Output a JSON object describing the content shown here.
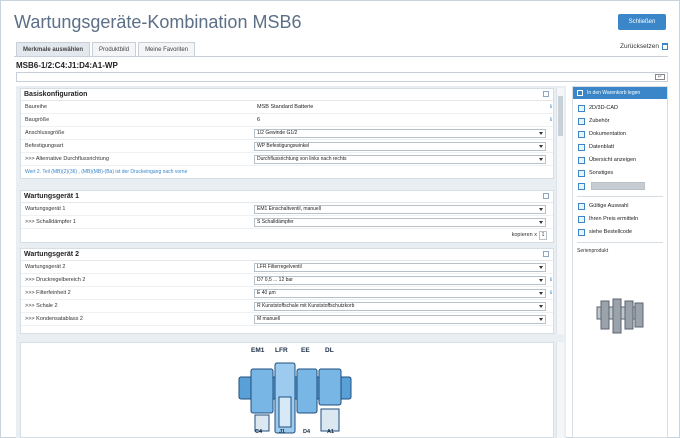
{
  "header": {
    "title": "Wartungsgeräte-Kombination MSB6",
    "close_label": "Schließen",
    "reset_label": "Zurücksetzen"
  },
  "tabs": [
    {
      "label": "Merkmale auswählen"
    },
    {
      "label": "Produktbild"
    },
    {
      "label": "Meine Favoriten"
    }
  ],
  "product_code": "MSB6-1/2:C4:J1:D4:A1-WP",
  "search_button": "↵",
  "basis": {
    "title": "Basiskonfiguration",
    "rows": [
      {
        "label": "Baureihe",
        "value": "MSB Standard Batterie"
      },
      {
        "label": "Baugröße",
        "value": "6"
      },
      {
        "label": "Anschlussgröße",
        "value": "1/2 Gewinde G1/2"
      },
      {
        "label": "Befestigungsart",
        "value": "WP Befestigungswinkel"
      },
      {
        "label": ">>> Alternative Durchflussrichtung",
        "value": "Durchflussrichtung von links nach rechts"
      }
    ],
    "link": "Wert 2. Teil (MB)(2)(36) , (MB)(MB)-(Ba) ist der Druckeingang nach vorne"
  },
  "wartung1": {
    "title": "Wartungsgerät 1",
    "rows": [
      {
        "label": "Wartungsgerät 1",
        "value": "EM1 Einschaltventil, manuell"
      },
      {
        "label": ">>> Schalldämpfer 1",
        "value": "S Schalldämpfer"
      }
    ],
    "copy_label": "kopieren x",
    "copy_value": "1"
  },
  "wartung2": {
    "title": "Wartungsgerät 2",
    "rows": [
      {
        "label": "Wartungsgerät 2",
        "value": "LFR Filterregelventil"
      },
      {
        "label": ">>> Druckregelbereich 2",
        "value": "D7 0,5 ... 12 bar"
      },
      {
        "label": ">>> Filterfeinheit 2",
        "value": "E 40 µm"
      },
      {
        "label": ">>> Schale 2",
        "value": "R Kunststoffschale mit Kunststoffschutzkorb"
      },
      {
        "label": ">>> Kondensatablass 2",
        "value": "M manuell"
      }
    ]
  },
  "product_image": {
    "top_labels": [
      "EM1",
      "LFR",
      "EE",
      "DL"
    ],
    "bottom_labels": [
      "C4",
      "J1",
      "D4",
      "A1"
    ]
  },
  "right_panel": {
    "header": "In den Warenkorb legen",
    "items": [
      {
        "label": "2D/3D-CAD",
        "icon": "cad-icon"
      },
      {
        "label": "Zubehör",
        "icon": "accessory-icon"
      },
      {
        "label": "Dokumentation",
        "icon": "document-icon"
      },
      {
        "label": "Datenblatt",
        "icon": "datasheet-icon"
      },
      {
        "label": "Übersicht anzeigen",
        "icon": "overview-icon"
      },
      {
        "label": "Sonstiges",
        "icon": "misc-icon"
      }
    ],
    "actions": [
      {
        "label": "Gültige Auswahl",
        "icon": "check-icon"
      },
      {
        "label": "Ihren Preis ermitteln",
        "icon": "price-icon"
      },
      {
        "label": "siehe Bestellcode",
        "icon": "info-icon"
      }
    ],
    "serien_label": "Serienprodukt"
  },
  "colors": {
    "accent": "#3a86c8",
    "title": "#5b6f86",
    "panel_bg": "#e9eef2"
  }
}
